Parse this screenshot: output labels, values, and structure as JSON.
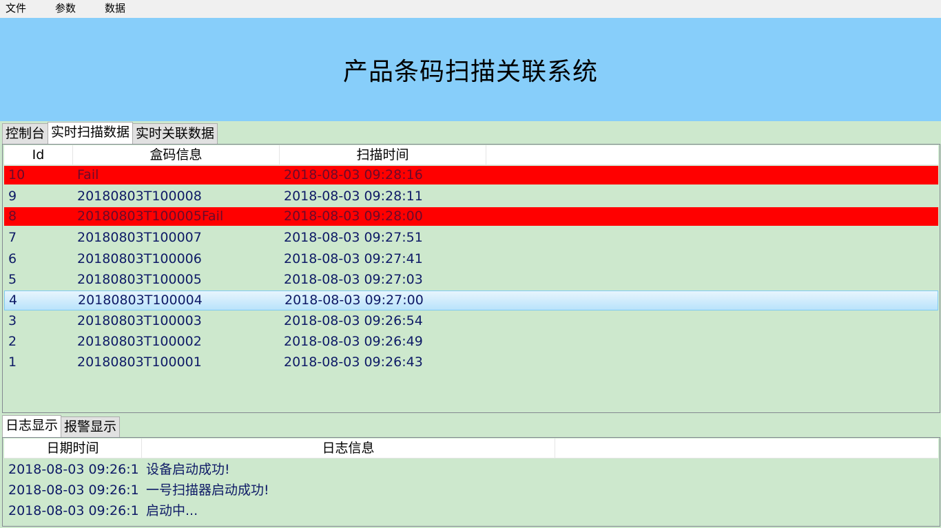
{
  "menu": {
    "items": [
      "文件",
      "参数",
      "数据"
    ]
  },
  "banner": {
    "title": "产品条码扫描关联系统",
    "bg_color": "#87cefa"
  },
  "main_tabs": {
    "items": [
      "控制台",
      "实时扫描数据",
      "实时关联数据"
    ],
    "active": "实时扫描数据"
  },
  "scan_table": {
    "columns": [
      "Id",
      "盒码信息",
      "扫描时间"
    ],
    "rows": [
      {
        "id": "10",
        "code": "Fail",
        "time": "2018-08-03 09:28:16",
        "state": "fail"
      },
      {
        "id": "9",
        "code": "20180803T100008",
        "time": "2018-08-03 09:28:11",
        "state": "normal"
      },
      {
        "id": "8",
        "code": "20180803T100005Fail",
        "time": "2018-08-03 09:28:00",
        "state": "fail"
      },
      {
        "id": "7",
        "code": "20180803T100007",
        "time": "2018-08-03 09:27:51",
        "state": "normal"
      },
      {
        "id": "6",
        "code": "20180803T100006",
        "time": "2018-08-03 09:27:41",
        "state": "normal"
      },
      {
        "id": "5",
        "code": "20180803T100005",
        "time": "2018-08-03 09:27:03",
        "state": "normal"
      },
      {
        "id": "4",
        "code": "20180803T100004",
        "time": "2018-08-03 09:27:00",
        "state": "selected"
      },
      {
        "id": "3",
        "code": "20180803T100003",
        "time": "2018-08-03 09:26:54",
        "state": "normal"
      },
      {
        "id": "2",
        "code": "20180803T100002",
        "time": "2018-08-03 09:26:49",
        "state": "normal"
      },
      {
        "id": "1",
        "code": "20180803T100001",
        "time": "2018-08-03 09:26:43",
        "state": "normal"
      }
    ],
    "fail_color": "#ff0000"
  },
  "log_tabs": {
    "items": [
      "日志显示",
      "报警显示"
    ],
    "active": "日志显示"
  },
  "log_table": {
    "columns": [
      "日期时间",
      "日志信息"
    ],
    "rows": [
      {
        "time": "2018-08-03 09:26:1",
        "message": "设备启动成功!"
      },
      {
        "time": "2018-08-03 09:26:1",
        "message": "一号扫描器启动成功!"
      },
      {
        "time": "2018-08-03 09:26:1",
        "message": "启动中..."
      }
    ]
  }
}
